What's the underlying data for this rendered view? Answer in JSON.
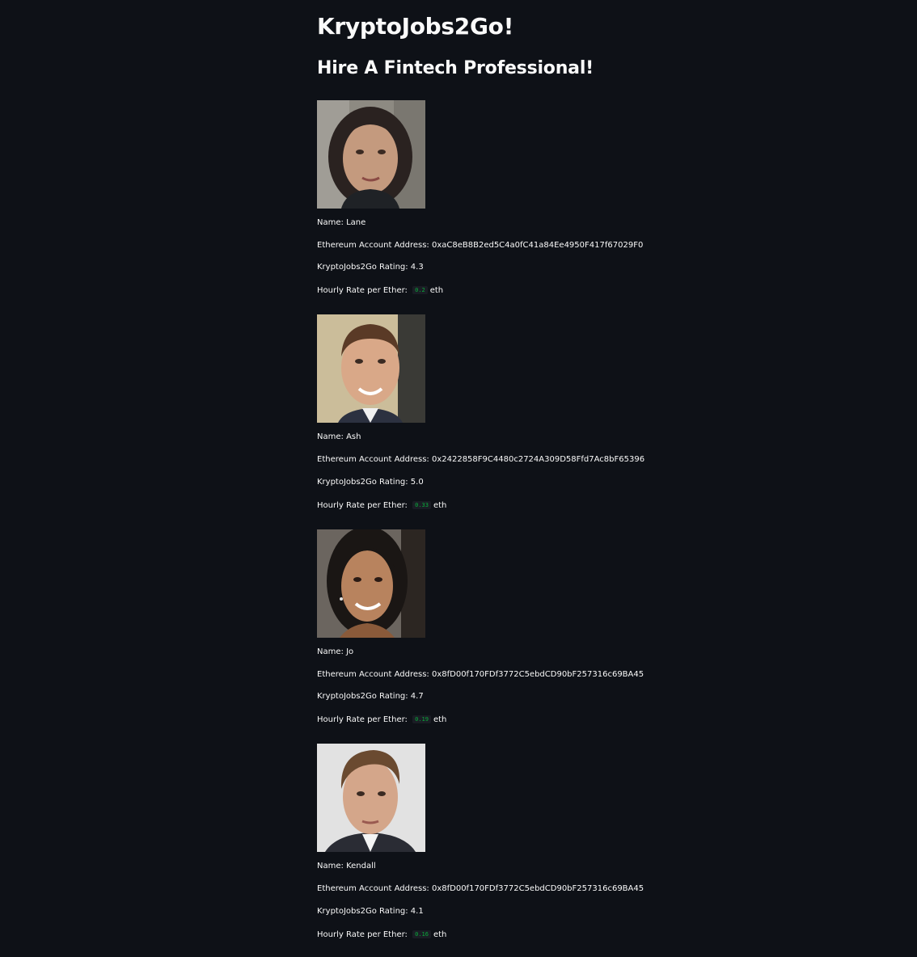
{
  "title": "KryptoJobs2Go!",
  "subtitle": "Hire A Fintech Professional!",
  "labels": {
    "name": "Name: ",
    "address": "Ethereum Account Address: ",
    "rating": "KryptoJobs2Go Rating: ",
    "rate": "Hourly Rate per Ether: ",
    "unit": "eth"
  },
  "candidates": [
    {
      "name": "Lane",
      "address": "0xaC8eB8B2ed5C4a0fC41a84Ee4950F417f67029F0",
      "rating": "4.3",
      "rate": "0.2",
      "photo": "portrait-woman-curly-dark-hair"
    },
    {
      "name": "Ash",
      "address": "0x2422858F9C4480c2724A309D58Ffd7Ac8bF65396",
      "rating": "5.0",
      "rate": "0.33",
      "photo": "portrait-man-short-brown-hair"
    },
    {
      "name": "Jo",
      "address": "0x8fD00f170FDf3772C5ebdCD90bF257316c69BA45",
      "rating": "4.7",
      "rate": "0.19",
      "photo": "portrait-woman-black-hair"
    },
    {
      "name": "Kendall",
      "address": "0x8fD00f170FDf3772C5ebdCD90bF257316c69BA45",
      "rating": "4.1",
      "rate": "0.16",
      "photo": "portrait-man-suit"
    }
  ]
}
